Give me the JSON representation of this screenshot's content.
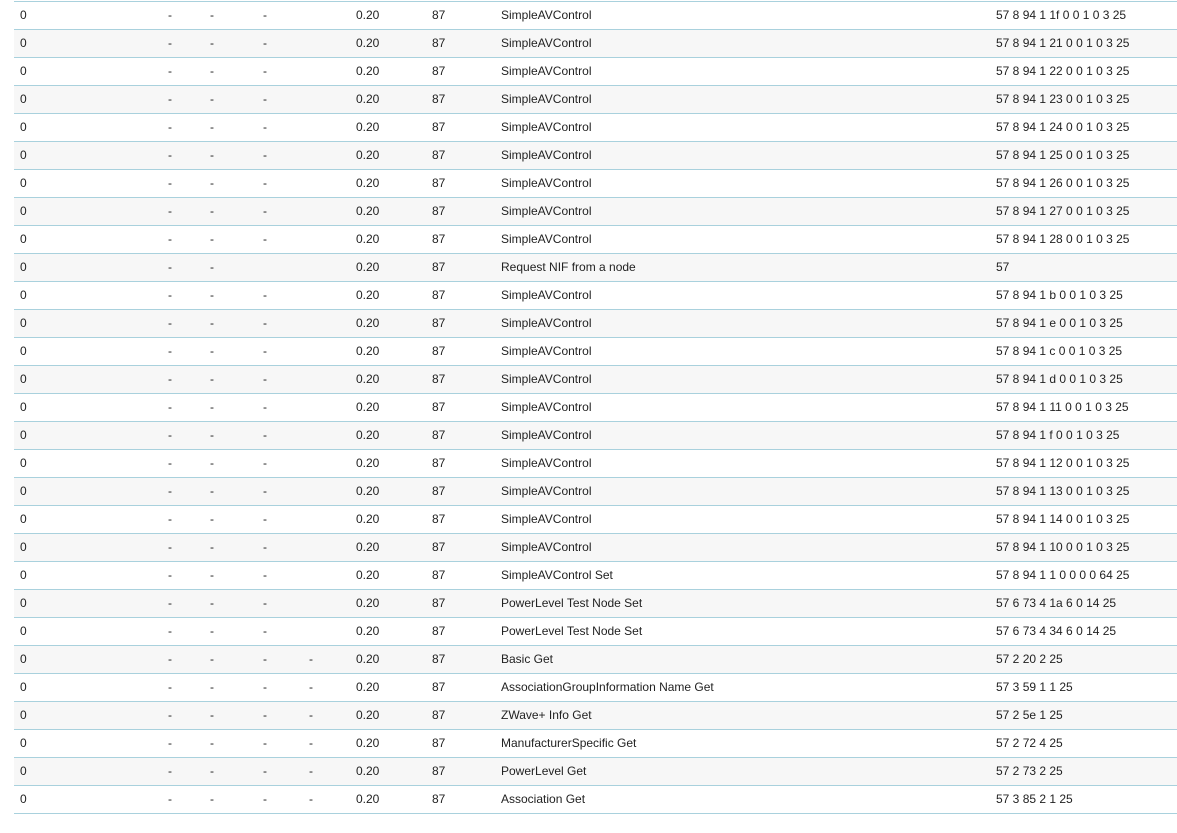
{
  "log_table": {
    "rows": [
      [
        "0",
        "-",
        "-",
        "-",
        "",
        "0.20",
        "87",
        "SimpleAVControl",
        "57 8 94 1 1f 0 0 1 0 3 25"
      ],
      [
        "0",
        "-",
        "-",
        "-",
        "",
        "0.20",
        "87",
        "SimpleAVControl",
        "57 8 94 1 21 0 0 1 0 3 25"
      ],
      [
        "0",
        "-",
        "-",
        "-",
        "",
        "0.20",
        "87",
        "SimpleAVControl",
        "57 8 94 1 22 0 0 1 0 3 25"
      ],
      [
        "0",
        "-",
        "-",
        "-",
        "",
        "0.20",
        "87",
        "SimpleAVControl",
        "57 8 94 1 23 0 0 1 0 3 25"
      ],
      [
        "0",
        "-",
        "-",
        "-",
        "",
        "0.20",
        "87",
        "SimpleAVControl",
        "57 8 94 1 24 0 0 1 0 3 25"
      ],
      [
        "0",
        "-",
        "-",
        "-",
        "",
        "0.20",
        "87",
        "SimpleAVControl",
        "57 8 94 1 25 0 0 1 0 3 25"
      ],
      [
        "0",
        "-",
        "-",
        "-",
        "",
        "0.20",
        "87",
        "SimpleAVControl",
        "57 8 94 1 26 0 0 1 0 3 25"
      ],
      [
        "0",
        "-",
        "-",
        "-",
        "",
        "0.20",
        "87",
        "SimpleAVControl",
        "57 8 94 1 27 0 0 1 0 3 25"
      ],
      [
        "0",
        "-",
        "-",
        "-",
        "",
        "0.20",
        "87",
        "SimpleAVControl",
        "57 8 94 1 28 0 0 1 0 3 25"
      ],
      [
        "0",
        "-",
        "-",
        "",
        "",
        "0.20",
        "87",
        "Request NIF from a node",
        "57"
      ],
      [
        "0",
        "-",
        "-",
        "-",
        "",
        "0.20",
        "87",
        "SimpleAVControl",
        "57 8 94 1 b 0 0 1 0 3 25"
      ],
      [
        "0",
        "-",
        "-",
        "-",
        "",
        "0.20",
        "87",
        "SimpleAVControl",
        "57 8 94 1 e 0 0 1 0 3 25"
      ],
      [
        "0",
        "-",
        "-",
        "-",
        "",
        "0.20",
        "87",
        "SimpleAVControl",
        "57 8 94 1 c 0 0 1 0 3 25"
      ],
      [
        "0",
        "-",
        "-",
        "-",
        "",
        "0.20",
        "87",
        "SimpleAVControl",
        "57 8 94 1 d 0 0 1 0 3 25"
      ],
      [
        "0",
        "-",
        "-",
        "-",
        "",
        "0.20",
        "87",
        "SimpleAVControl",
        "57 8 94 1 11 0 0 1 0 3 25"
      ],
      [
        "0",
        "-",
        "-",
        "-",
        "",
        "0.20",
        "87",
        "SimpleAVControl",
        "57 8 94 1 f 0 0 1 0 3 25"
      ],
      [
        "0",
        "-",
        "-",
        "-",
        "",
        "0.20",
        "87",
        "SimpleAVControl",
        "57 8 94 1 12 0 0 1 0 3 25"
      ],
      [
        "0",
        "-",
        "-",
        "-",
        "",
        "0.20",
        "87",
        "SimpleAVControl",
        "57 8 94 1 13 0 0 1 0 3 25"
      ],
      [
        "0",
        "-",
        "-",
        "-",
        "",
        "0.20",
        "87",
        "SimpleAVControl",
        "57 8 94 1 14 0 0 1 0 3 25"
      ],
      [
        "0",
        "-",
        "-",
        "-",
        "",
        "0.20",
        "87",
        "SimpleAVControl",
        "57 8 94 1 10 0 0 1 0 3 25"
      ],
      [
        "0",
        "-",
        "-",
        "-",
        "",
        "0.20",
        "87",
        "SimpleAVControl Set",
        "57 8 94 1 1 0 0 0 0 64 25"
      ],
      [
        "0",
        "-",
        "-",
        "-",
        "",
        "0.20",
        "87",
        "PowerLevel Test Node Set",
        "57 6 73 4 1a 6 0 14 25"
      ],
      [
        "0",
        "-",
        "-",
        "-",
        "",
        "0.20",
        "87",
        "PowerLevel Test Node Set",
        "57 6 73 4 34 6 0 14 25"
      ],
      [
        "0",
        "-",
        "-",
        "-",
        "-",
        "0.20",
        "87",
        "Basic Get",
        "57 2 20 2 25"
      ],
      [
        "0",
        "-",
        "-",
        "-",
        "-",
        "0.20",
        "87",
        "AssociationGroupInformation Name Get",
        "57 3 59 1 1 25"
      ],
      [
        "0",
        "-",
        "-",
        "-",
        "-",
        "0.20",
        "87",
        "ZWave+ Info Get",
        "57 2 5e 1 25"
      ],
      [
        "0",
        "-",
        "-",
        "-",
        "-",
        "0.20",
        "87",
        "ManufacturerSpecific Get",
        "57 2 72 4 25"
      ],
      [
        "0",
        "-",
        "-",
        "-",
        "-",
        "0.20",
        "87",
        "PowerLevel Get",
        "57 2 73 2 25"
      ],
      [
        "0",
        "-",
        "-",
        "-",
        "-",
        "0.20",
        "87",
        "Association Get",
        "57 3 85 2 1 25"
      ]
    ]
  }
}
